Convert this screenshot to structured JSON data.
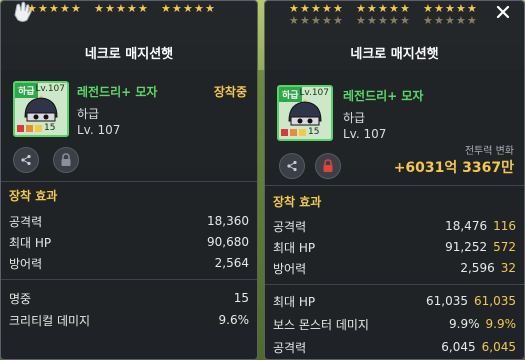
{
  "left_panel": {
    "title": "네크로 매지션햇",
    "item": {
      "grade_tag": "하급",
      "level_tag": "Lv.107",
      "name": "레전드리+ 모자",
      "grade": "하급",
      "level": "Lv. 107",
      "enhance": "15"
    },
    "equipped_label": "장착중",
    "section_title": "장착 효과",
    "stats": [
      {
        "name": "공격력",
        "value": "18,360"
      },
      {
        "name": "최대 HP",
        "value": "90,680"
      },
      {
        "name": "방어력",
        "value": "2,564"
      }
    ],
    "extra_stats": [
      {
        "name": "명중",
        "value": "15"
      },
      {
        "name": "크리티컬 데미지",
        "value": "9.6%"
      }
    ]
  },
  "right_panel": {
    "title": "네크로 매지션햇",
    "item": {
      "grade_tag": "하급",
      "level_tag": "Lv.107",
      "name": "레전드리+ 모자",
      "grade": "하급",
      "level": "Lv. 107",
      "enhance": "15"
    },
    "combat_power_label": "전투력 변화",
    "combat_power_value": "+6031억 3367만",
    "section_title": "장착 효과",
    "stats": [
      {
        "name": "공격력",
        "value": "18,476",
        "diff": "116"
      },
      {
        "name": "최대 HP",
        "value": "91,252",
        "diff": "572"
      },
      {
        "name": "방어력",
        "value": "2,596",
        "diff": "32"
      }
    ],
    "extra_stats": [
      {
        "name": "최대 HP",
        "value": "61,035",
        "diff": "61,035"
      },
      {
        "name": "보스 몬스터 데미지",
        "value": "9.9%",
        "diff": "9.9%"
      },
      {
        "name": "공격력",
        "value": "6,045",
        "diff": "6,045"
      }
    ]
  },
  "colors": {
    "accent_gold": "#f2c94c",
    "item_name_green": "#5dd66b",
    "lock_red": "#e0433c"
  },
  "icons": {
    "glove": "glove-icon",
    "close": "close-icon",
    "share": "share-icon",
    "lock": "lock-icon",
    "star": "star-icon",
    "helmet": "helmet-icon"
  }
}
